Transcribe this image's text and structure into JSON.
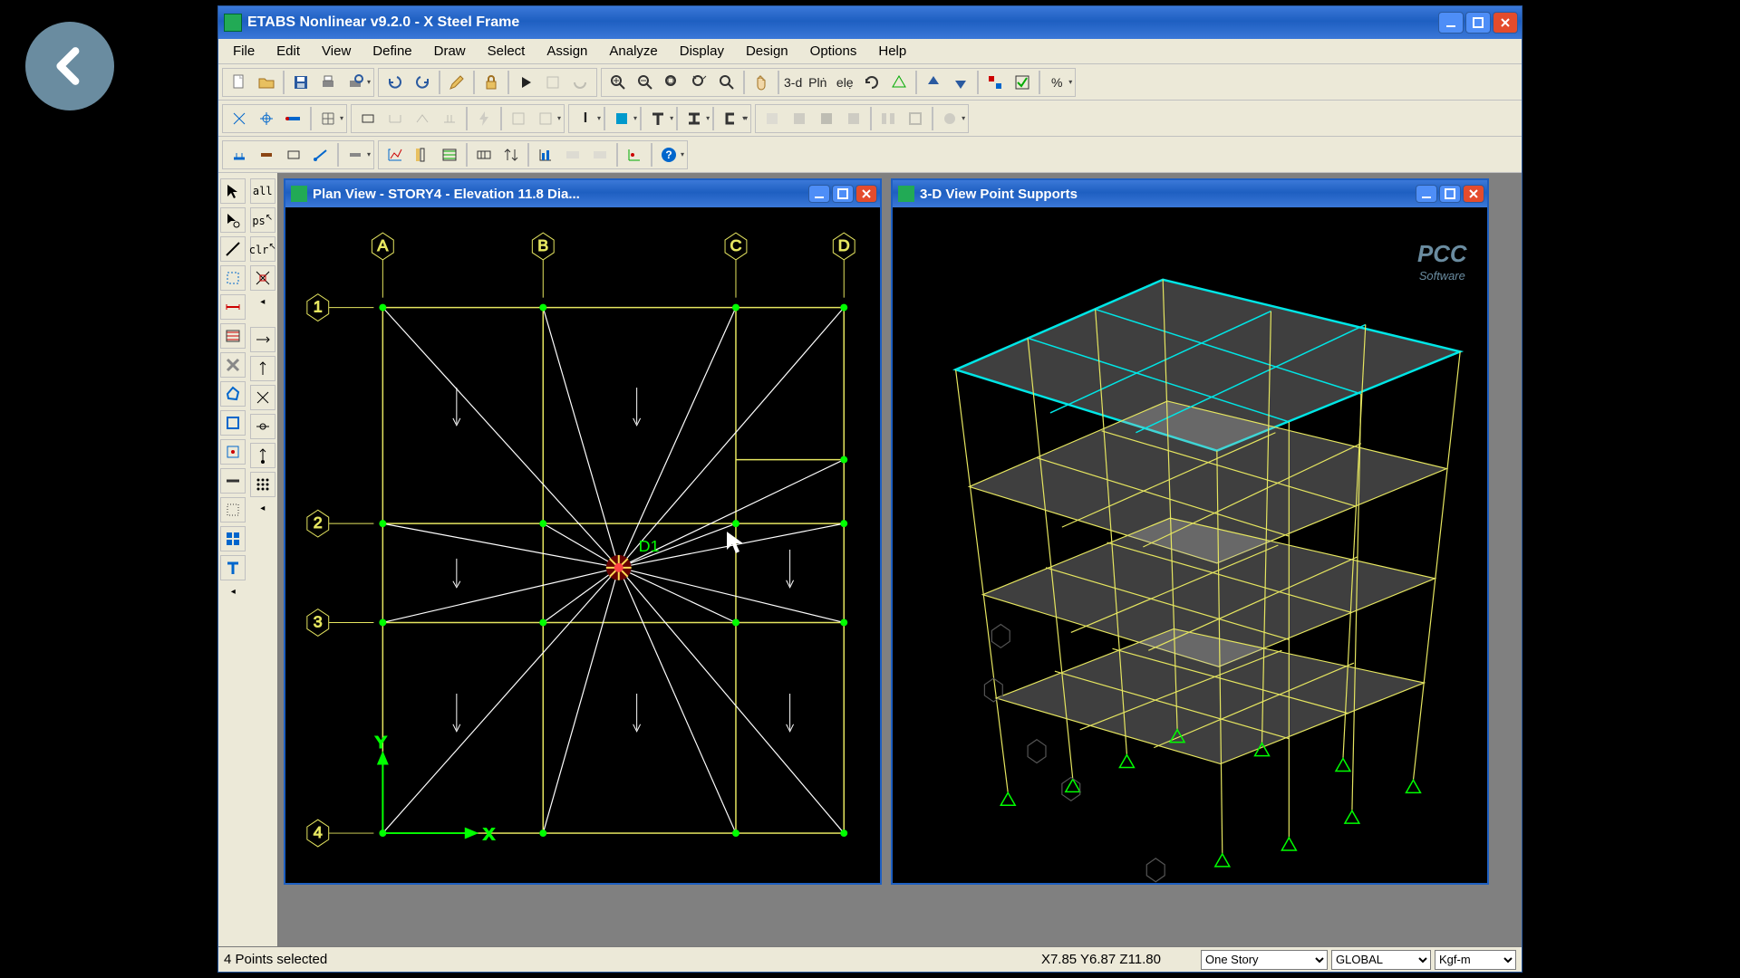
{
  "app": {
    "title": "ETABS Nonlinear v9.2.0 - X Steel Frame"
  },
  "menubar": [
    "File",
    "Edit",
    "View",
    "Define",
    "Draw",
    "Select",
    "Assign",
    "Analyze",
    "Display",
    "Design",
    "Options",
    "Help"
  ],
  "toolbar1": {
    "text3d": "3-d"
  },
  "child_windows": {
    "plan": {
      "title": "Plan View - STORY4 - Elevation 11.8  Dia..."
    },
    "view3d": {
      "title": "3-D View  Point Supports"
    }
  },
  "plan_grid": {
    "col_labels": [
      "A",
      "B",
      "C",
      "D"
    ],
    "row_labels": [
      "1",
      "2",
      "3",
      "4"
    ],
    "center_label": "D1"
  },
  "status": {
    "msg": "4 Points selected",
    "coords": "X7.85  Y6.87  Z11.80",
    "story_sel": "One Story",
    "coord_sys": "GLOBAL",
    "units": "Kgf-m"
  },
  "logo3d": "PCC"
}
